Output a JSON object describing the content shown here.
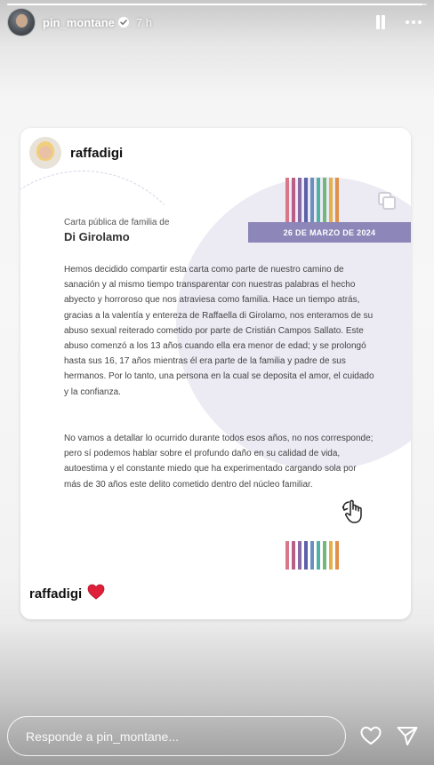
{
  "story": {
    "progress": 0.99,
    "username": "pin_montane",
    "time": "7 h"
  },
  "post": {
    "username": "raffadigi",
    "caption_username": "raffadigi",
    "caption_emoji_icon": "red-heart-icon"
  },
  "letter": {
    "subtitle": "Carta pública de familia de",
    "family_name": "Di Girolamo",
    "date": "26 DE MARZO DE 2024",
    "paragraph1": "Hemos decidido compartir esta carta como parte de nuestro camino de sanación y al mismo tiempo transparentar con nuestras palabras el hecho abyecto y horroroso que nos atraviesa como familia. Hace un tiempo atrás, gracias a la valentía y entereza de Raffaella di Girolamo, nos enteramos de su abuso sexual reiterado cometido por parte de Cristián Campos Sallato. Este abuso comenzó a los 13 años cuando ella era menor de edad; y se prolongó hasta sus 16, 17 años mientras él era parte de la familia y padre de sus hermanos. Por lo tanto, una persona en la cual se deposita el amor, el cuidado y la confianza.",
    "paragraph2": "No vamos a detallar lo ocurrido durante todos esos años, no nos corresponde; pero sí podemos hablar sobre el profundo daño en su calidad de vida, autoestima y el constante miedo que ha experimentado cargando sola por más de 30 años este delito cometido dentro del núcleo familiar.",
    "stripe_colors": [
      "#d9778a",
      "#b95f86",
      "#8a6aa6",
      "#5d62a8",
      "#6a8fc0",
      "#4fb0a6",
      "#74b77d",
      "#e6b14b",
      "#e0904a"
    ],
    "accent_color": "#8d86b8"
  },
  "reply": {
    "placeholder": "Responde a pin_montane..."
  }
}
